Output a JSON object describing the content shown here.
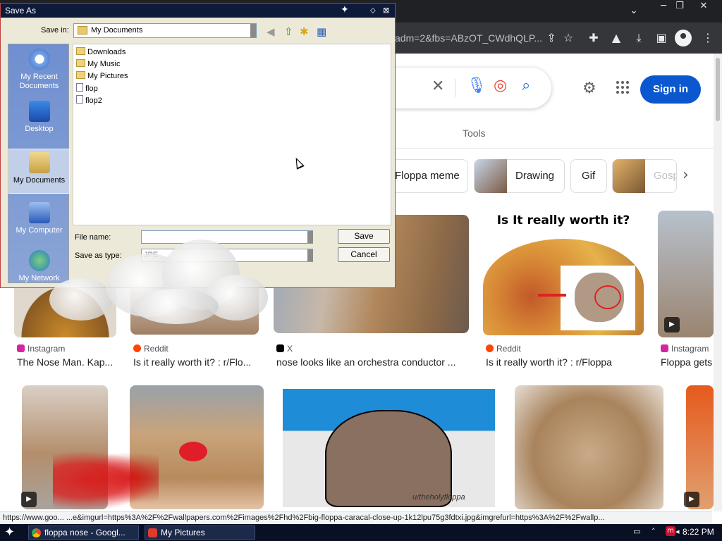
{
  "browser": {
    "url_fragment": "adm=2&fbs=ABzOT_CWdhQLP...",
    "window_controls": [
      "─",
      "❐",
      "✕"
    ],
    "chevron": "⌄",
    "toolbar_icons": [
      "share-icon",
      "star-icon",
      "extensions-icon",
      "flask-icon",
      "download-icon",
      "sidepanel-icon",
      "profile-icon",
      "menu-icon"
    ]
  },
  "google": {
    "signin_label": "Sign in",
    "tools_label": "Tools",
    "chips": [
      "Floppa meme",
      "Drawing",
      "Gif",
      "Gosp"
    ],
    "results_row1": [
      {
        "source": "Instagram",
        "caption": "The Nose Man. Kap...",
        "source_color": "#d6249f"
      },
      {
        "source": "Reddit",
        "caption": "Is it really worth it? : r/Flo...",
        "source_color": "#ff4500"
      },
      {
        "source": "X",
        "caption": "nose looks like an orchestra conductor ...",
        "source_color": "#000000"
      },
      {
        "source": "Reddit",
        "caption": "Is it really worth it? : r/Floppa",
        "source_color": "#ff4500"
      },
      {
        "source": "Instagram",
        "caption": "Floppa gets",
        "source_color": "#d6249f"
      }
    ],
    "image_text": {
      "meme_title": "Is It really worth it?",
      "watermark": "u/theholyfloppa"
    }
  },
  "status_url": "https://www.goo...   ...e&imgurl=https%3A%2F%2Fwallpapers.com%2Fimages%2Fhd%2Fbig-floppa-caracal-close-up-1k12lpu75g3fdtxi.jpg&imgrefurl=https%3A%2F%2Fwallp...",
  "taskbar": {
    "tasks": [
      "floppa nose - Googl...",
      "My Pictures"
    ],
    "clock": "8:22 PM"
  },
  "dialog": {
    "title": "Save As",
    "save_in_label": "Save in:",
    "save_in_value": "My Documents",
    "places": [
      "My Recent Documents",
      "Desktop",
      "My Documents",
      "My Computer",
      "My Network"
    ],
    "files": [
      {
        "name": "Downloads",
        "type": "folder"
      },
      {
        "name": "My Music",
        "type": "folder"
      },
      {
        "name": "My Pictures",
        "type": "folder"
      },
      {
        "name": "flop",
        "type": "file"
      },
      {
        "name": "flop2",
        "type": "file"
      }
    ],
    "file_name_label": "File name:",
    "file_name_value": "",
    "save_type_label": "Save as type:",
    "save_type_value": "JPE",
    "save_button": "Save",
    "cancel_button": "Cancel"
  }
}
